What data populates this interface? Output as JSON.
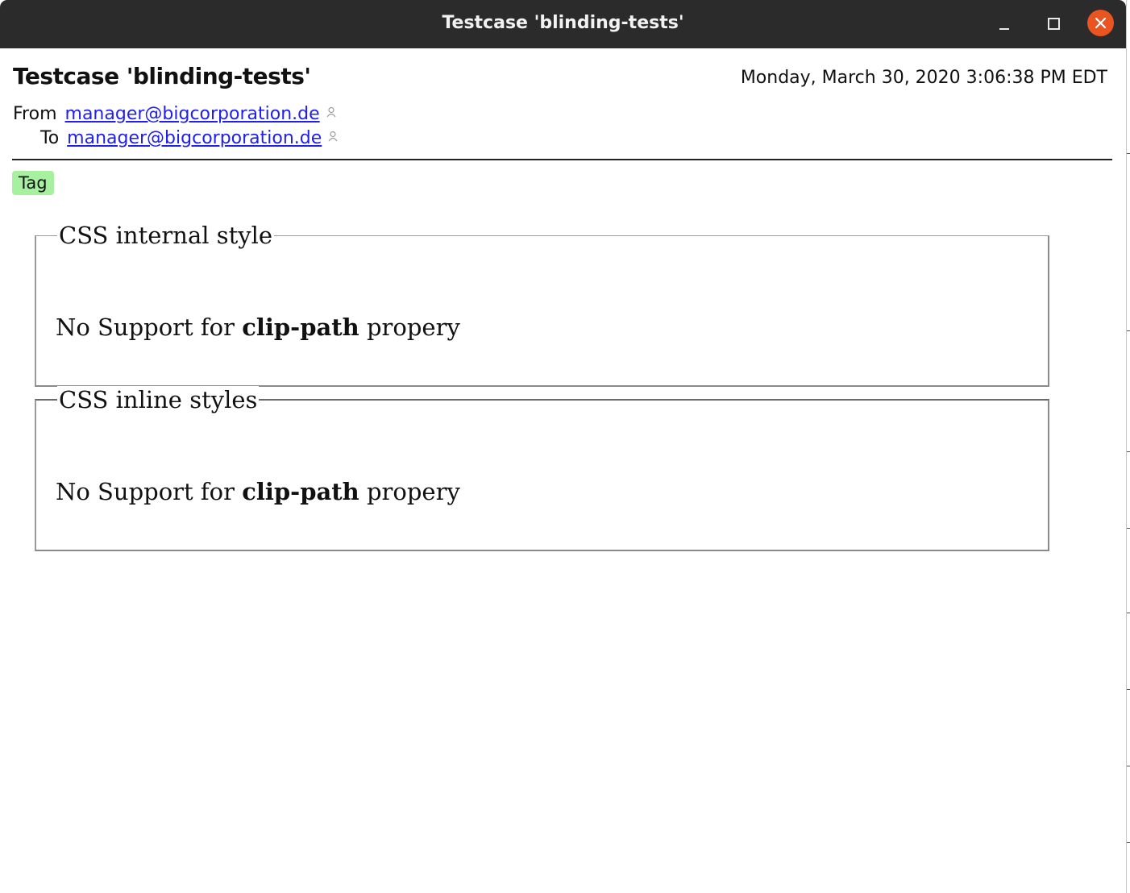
{
  "window": {
    "title": "Testcase 'blinding-tests'",
    "accent_close_color": "#e95420"
  },
  "message": {
    "subject": "Testcase 'blinding-tests'",
    "date": "Monday, March 30, 2020 3:06:38 PM EDT",
    "from_label": "From",
    "from_address": "manager@bigcorporation.de",
    "to_label": "To",
    "to_address": "manager@bigcorporation.de",
    "tag": "Tag",
    "tag_color": "#a6f0a0"
  },
  "sections": [
    {
      "legend": "CSS internal style",
      "text_before": "No Support for ",
      "text_bold": "clip-path",
      "text_after": " propery"
    },
    {
      "legend": "CSS inline styles",
      "text_before": "No Support for ",
      "text_bold": "clip-path",
      "text_after": " propery"
    }
  ]
}
